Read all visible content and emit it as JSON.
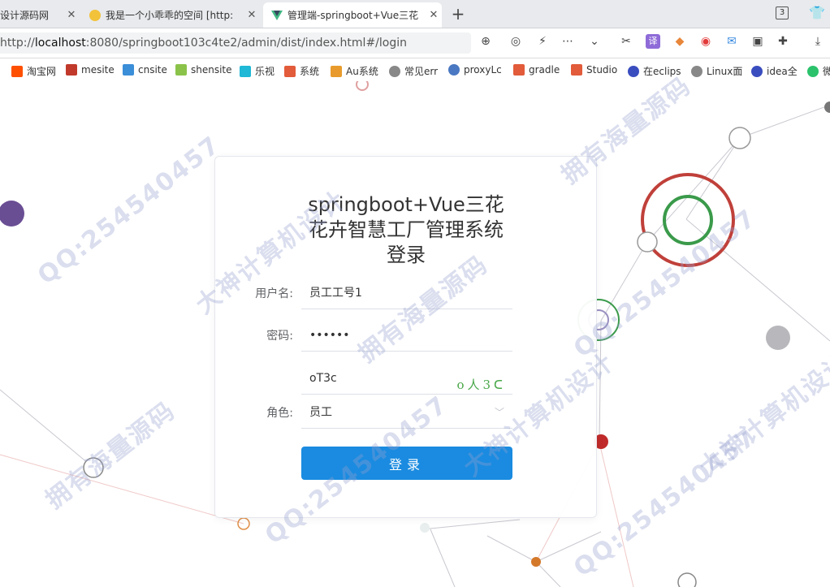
{
  "tabs": [
    {
      "title": "设计源码网",
      "close": "✕",
      "favicon_color": "#dddddd"
    },
    {
      "title": "我是一个小乖乖的空间 [http:",
      "close": "✕",
      "favicon_color": "#f2c23a"
    },
    {
      "title": "管理端-springboot+Vue三花",
      "close": "✕",
      "favicon_color": "#41b883",
      "active": true
    }
  ],
  "new_tab": "+",
  "tab_count": "3",
  "address": {
    "host": "localhost",
    "prefix": "http://",
    "rest": ":8080/springboot103c4te2/admin/dist/index.html#/login"
  },
  "toolbar_icons": [
    "zoom-icon",
    "compass-icon",
    "bolt-icon",
    "more-icon",
    "chevron-down-icon",
    "scissors-icon",
    "translate-icon",
    "game-icon",
    "weibo-icon",
    "mail-icon",
    "screenshot-icon",
    "extension-icon",
    "download-icon"
  ],
  "bookmarks": [
    {
      "label": "淘宝网",
      "color": "#ff5000"
    },
    {
      "label": "mesite",
      "color": "#c0392b"
    },
    {
      "label": "cnsite",
      "color": "#3b8ed8"
    },
    {
      "label": "shensite",
      "color": "#8bc34a"
    },
    {
      "label": "乐视",
      "color": "#1fb8d6"
    },
    {
      "label": "系统",
      "color": "#e25b3a"
    },
    {
      "label": "Au系统",
      "color": "#e89b2c"
    },
    {
      "label": "常见err",
      "color": "#888888"
    },
    {
      "label": "proxyLc",
      "color": "#4a78c2"
    },
    {
      "label": "gradle",
      "color": "#e25b3a"
    },
    {
      "label": "Studio",
      "color": "#e25b3a"
    },
    {
      "label": "在eclips",
      "color": "#3a4dbf"
    },
    {
      "label": "Linux面",
      "color": "#888888"
    },
    {
      "label": "idea全",
      "color": "#3a4dbf"
    },
    {
      "label": "微",
      "color": "#2bc26b"
    }
  ],
  "login": {
    "title": "springboot+Vue三花花卉智慧工厂管理系统登录",
    "title_lines": [
      "springboot+Vue三花",
      "花卉智慧工厂管理系统",
      "登录"
    ],
    "username_label": "用户名:",
    "username_value": "员工工号1",
    "password_label": "密码:",
    "password_value": "••••••",
    "captcha_value": "oT3c",
    "captcha_image_text": "o人3ᑕ",
    "role_label": "角色:",
    "role_value": "员工",
    "role_arrow": "﹀",
    "button_label": "登录"
  },
  "watermarks": [
    "大神计算机设计",
    "QQ:254540457",
    "拥有海量源码"
  ]
}
